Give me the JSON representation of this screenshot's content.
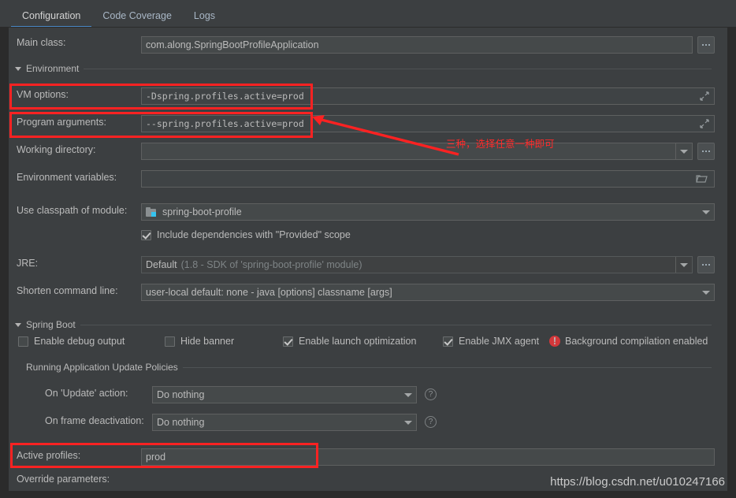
{
  "colors": {
    "background": "#3c3f41",
    "field": "#45494a",
    "accent": "#4a88c7",
    "annotation_red": "#fb2222",
    "error_red": "#d4373a",
    "module_icon_blue": "#35c4ef"
  },
  "tabs": [
    {
      "label": "Configuration",
      "active": true
    },
    {
      "label": "Code Coverage",
      "active": false
    },
    {
      "label": "Logs",
      "active": false
    }
  ],
  "main_class": {
    "label": "Main class:",
    "value": "com.along.SpringBootProfileApplication",
    "browse_label": "..."
  },
  "environment_section": {
    "title": "Environment",
    "vm_options": {
      "label": "VM options:",
      "value": "-Dspring.profiles.active=prod"
    },
    "program_arguments": {
      "label": "Program arguments:",
      "value": "--spring.profiles.active=prod"
    },
    "working_directory": {
      "label": "Working directory:",
      "value": ""
    },
    "environment_variables": {
      "label": "Environment variables:",
      "value": ""
    },
    "use_classpath_of_module": {
      "label": "Use classpath of module:",
      "value": "spring-boot-profile"
    },
    "include_provided": {
      "label": "Include dependencies with \"Provided\" scope",
      "checked": true
    },
    "jre": {
      "label": "JRE:",
      "value": "Default",
      "value_hint": "(1.8 - SDK of 'spring-boot-profile' module)"
    },
    "shorten_command_line": {
      "label": "Shorten command line:",
      "value": "user-local default: none - java [options] classname [args]"
    }
  },
  "spring_boot_section": {
    "title": "Spring Boot",
    "checkboxes": [
      {
        "label": "Enable debug output",
        "checked": false
      },
      {
        "label": "Hide banner",
        "checked": false
      },
      {
        "label": "Enable launch optimization",
        "checked": true
      },
      {
        "label": "Enable JMX agent",
        "checked": true
      }
    ],
    "background_compilation": {
      "label": "Background compilation enabled",
      "icon": "error-icon"
    },
    "update_policies": {
      "title": "Running Application Update Policies",
      "on_update_action": {
        "label": "On 'Update' action:",
        "value": "Do nothing"
      },
      "on_frame_deactivation": {
        "label": "On frame deactivation:",
        "value": "Do nothing"
      },
      "help_label": "?"
    },
    "active_profiles": {
      "label": "Active profiles:",
      "value": "prod"
    },
    "override_parameters": {
      "label": "Override parameters:"
    }
  },
  "annotations": {
    "chinese_note": "三种，选择任意一种即可"
  },
  "watermark": {
    "text": "https://blog.csdn.net/u010247166"
  }
}
